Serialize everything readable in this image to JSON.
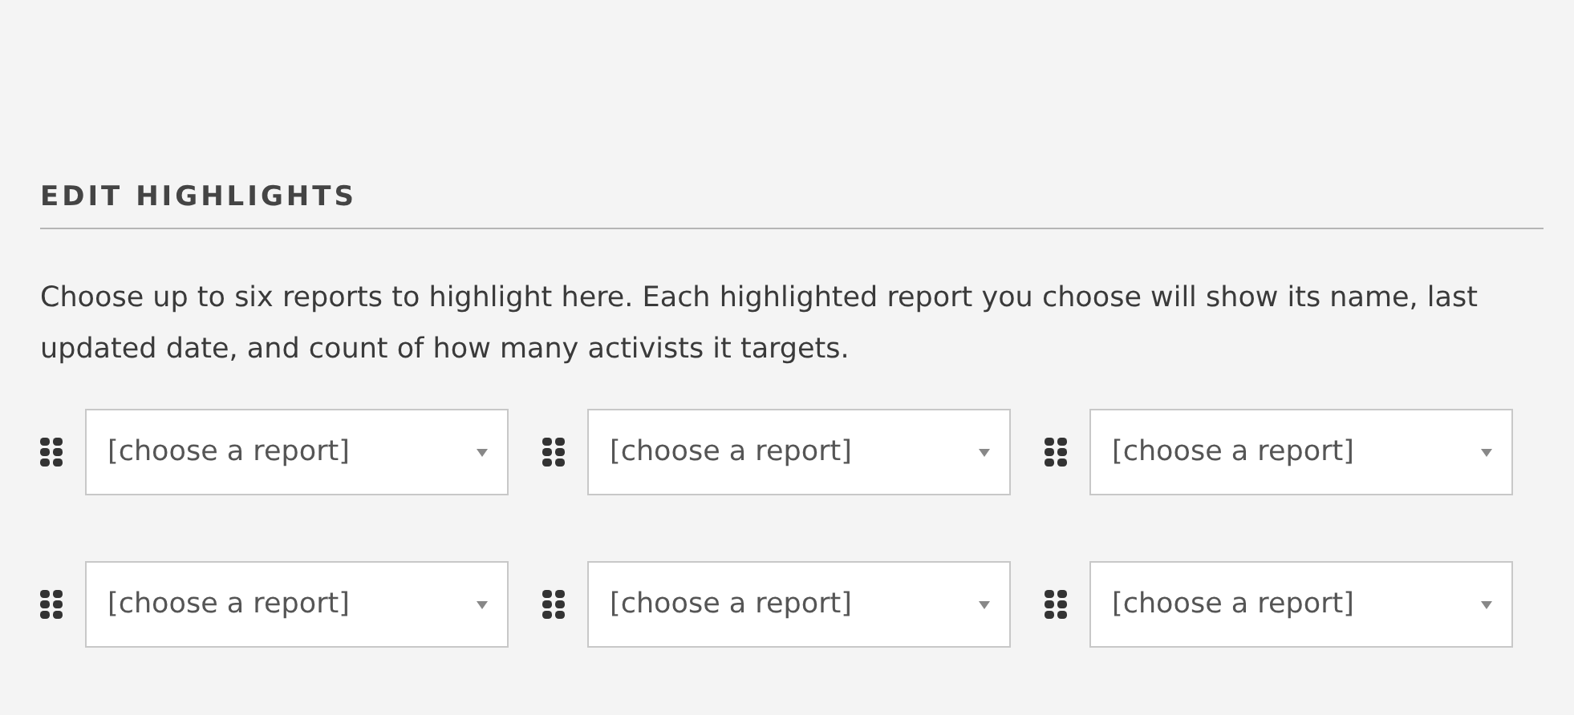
{
  "section": {
    "title": "EDIT HIGHLIGHTS",
    "description": "Choose up to six reports to highlight here. Each highlighted report you choose will show its name, last updated date, and count of how many activists it targets."
  },
  "highlights": [
    {
      "placeholder": "[choose a report]"
    },
    {
      "placeholder": "[choose a report]"
    },
    {
      "placeholder": "[choose a report]"
    },
    {
      "placeholder": "[choose a report]"
    },
    {
      "placeholder": "[choose a report]"
    },
    {
      "placeholder": "[choose a report]"
    }
  ]
}
